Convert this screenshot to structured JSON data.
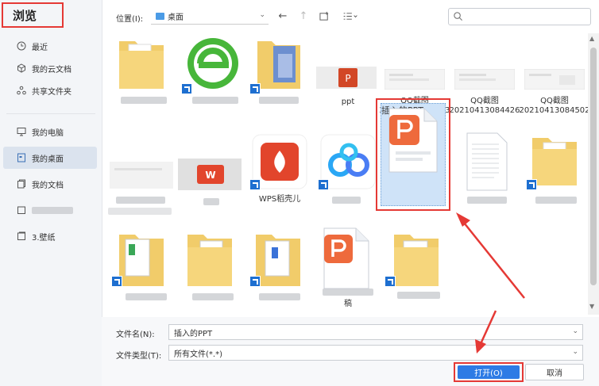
{
  "sidebar": {
    "title": "浏览",
    "items": [
      {
        "label": "最近",
        "icon": "clock-icon"
      },
      {
        "label": "我的云文档",
        "icon": "cloud-doc-icon"
      },
      {
        "label": "共享文件夹",
        "icon": "share-folder-icon"
      },
      {
        "label": "我的电脑",
        "icon": "monitor-icon"
      },
      {
        "label": "我的桌面",
        "icon": "desktop-icon",
        "active": true
      },
      {
        "label": "我的文档",
        "icon": "documents-icon"
      },
      {
        "label": "",
        "icon": "folder-icon"
      },
      {
        "label": "3.壁纸",
        "icon": "folder-icon"
      }
    ]
  },
  "toolbar": {
    "location_label": "位置(I):",
    "location_value": "桌面",
    "search_placeholder": ""
  },
  "files": {
    "ppt": "ppt",
    "qq1_line1": "QQ截图",
    "qq1_line2": "20210413084403",
    "qq2_line1": "QQ截图",
    "qq2_line2": "20210413084426",
    "qq3_line1": "QQ截图",
    "qq3_line2": "20210413084502",
    "wps_shell": "WPS稻壳儿",
    "inserted_ppt": "插入的PPT",
    "gao": "稿"
  },
  "bottom": {
    "filename_label": "文件名(N):",
    "filename_value": "插入的PPT",
    "filetype_label": "文件类型(T):",
    "filetype_value": "所有文件(*.*)",
    "open_button": "打开(O)",
    "cancel_button": "取消"
  },
  "colors": {
    "accent": "#2d7be5",
    "highlight": "#e53935",
    "selection": "#cfe3f8",
    "wps_red": "#e2452c",
    "ppt_orange": "#ee6a3c"
  }
}
